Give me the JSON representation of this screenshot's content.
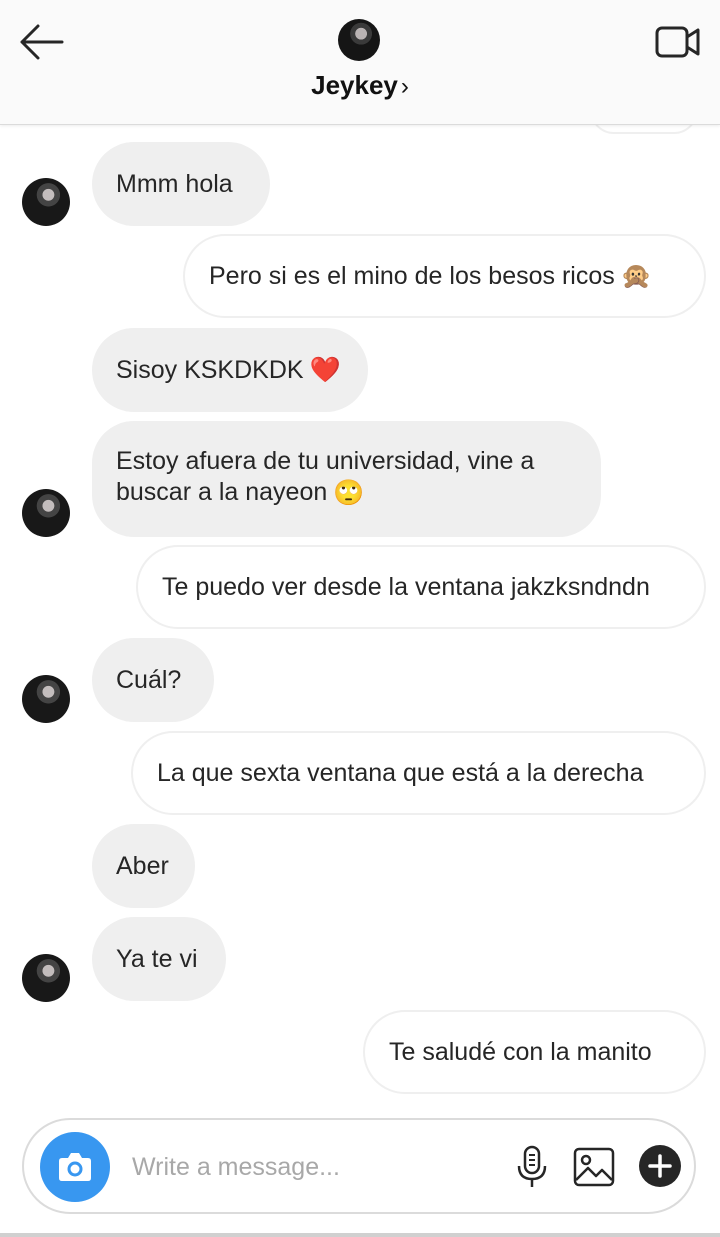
{
  "header": {
    "contact_name": "Jeykey",
    "chevron": "›",
    "back_icon": "arrow-left-icon",
    "video_icon": "video-camera-icon"
  },
  "messages": [
    {
      "side": "received",
      "text": "Mmm hola"
    },
    {
      "side": "sent",
      "text": "Pero si es el mino de los besos ricos",
      "emoji": "🙊"
    },
    {
      "side": "received",
      "text": "Sisoy KSKDKDK",
      "emoji": "❤️"
    },
    {
      "side": "received",
      "text": "Estoy afuera de tu universidad, vine a buscar a la nayeon",
      "emoji": "🙄"
    },
    {
      "side": "sent",
      "text": "Te puedo ver desde la ventana jakzksndndn"
    },
    {
      "side": "received",
      "text": "Cuál?"
    },
    {
      "side": "sent",
      "text": "La que sexta ventana que está a la derecha"
    },
    {
      "side": "received",
      "text": "Aber"
    },
    {
      "side": "received",
      "text": "Ya te vi"
    },
    {
      "side": "sent",
      "text": "Te saludé con la manito"
    }
  ],
  "composer": {
    "placeholder": "Write a message...",
    "value": "",
    "camera_icon": "camera-icon",
    "mic_icon": "microphone-icon",
    "gallery_icon": "image-gallery-icon",
    "plus_icon": "plus-circle-icon"
  },
  "colors": {
    "received_bubble": "#efefef",
    "sent_bubble_border": "#efefef",
    "accent": "#3897f0",
    "text": "#262626",
    "placeholder": "#a8a8a8"
  }
}
